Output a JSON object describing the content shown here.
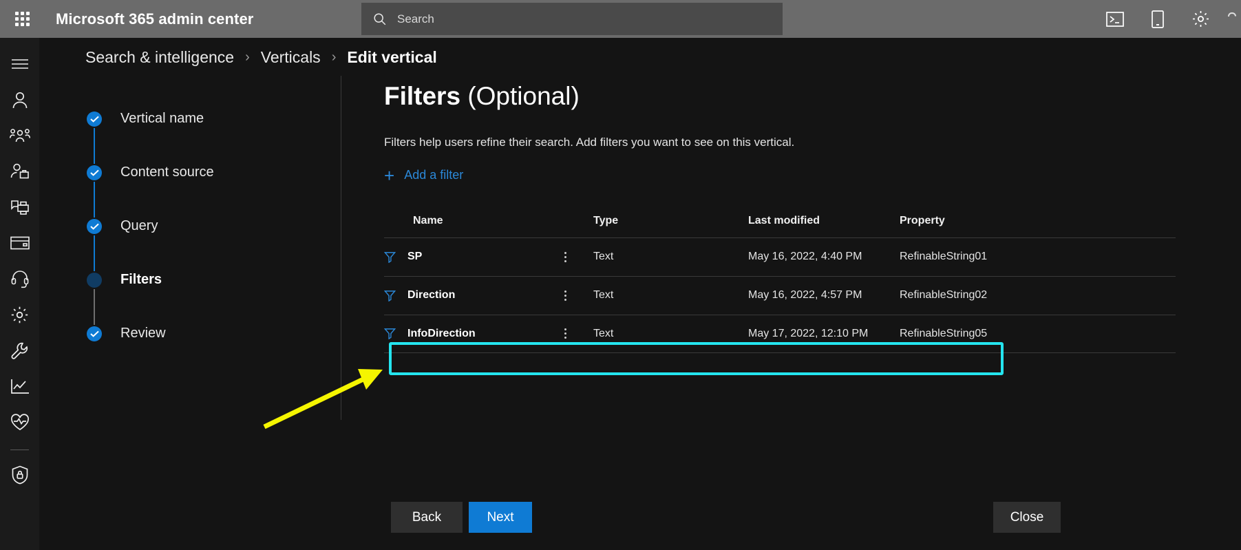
{
  "topbar": {
    "waffle_label": "app-launcher",
    "brand": "Microsoft 365 admin center",
    "search": {
      "value": "",
      "placeholder": "Search"
    },
    "icons": [
      {
        "name": "console-icon",
        "label": "Open command prompt"
      },
      {
        "name": "mobile-device-icon",
        "label": "Mobile device"
      },
      {
        "name": "gear-icon",
        "label": "Settings"
      }
    ]
  },
  "rail": {
    "items": [
      {
        "name": "hamburger-menu-icon",
        "label": "Show navigation menu"
      },
      {
        "name": "user-icon",
        "label": "Users"
      },
      {
        "name": "group-users-icon",
        "label": "Teams & groups"
      },
      {
        "name": "user-briefcase-icon",
        "label": "Roles"
      },
      {
        "name": "devices-printer-icon",
        "label": "Devices"
      },
      {
        "name": "credit-card-icon",
        "label": "Billing"
      },
      {
        "name": "headset-icon",
        "label": "Support"
      },
      {
        "name": "gear-icon",
        "label": "Settings"
      },
      {
        "name": "wrench-icon",
        "label": "Setup"
      },
      {
        "name": "chart-line-icon",
        "label": "Reports"
      },
      {
        "name": "heart-pulse-icon",
        "label": "Health"
      },
      {
        "name": "shield-lock-icon",
        "label": "Compliance"
      }
    ]
  },
  "breadcrumb": {
    "root": "Search & intelligence",
    "separator": "›",
    "parent": "Verticals",
    "current": "Edit vertical"
  },
  "wizard": {
    "steps": [
      {
        "label": "Vertical name",
        "state": "done"
      },
      {
        "label": "Content source",
        "state": "done"
      },
      {
        "label": "Query",
        "state": "done"
      },
      {
        "label": "Filters",
        "state": "current"
      },
      {
        "label": "Review",
        "state": "done"
      }
    ]
  },
  "main": {
    "title_bold": "Filters",
    "title_optional": " (Optional)",
    "description": "Filters help users refine their search. Add filters you want to see on this vertical.",
    "add_filter_label": "Add a filter",
    "add_filter_plus": "+",
    "table": {
      "columns": [
        "Name",
        "Type",
        "Last modified",
        "Property"
      ],
      "rows": [
        {
          "name": "SP",
          "type": "Text",
          "last_modified": "May 16, 2022, 4:40 PM",
          "property": "RefinableString01",
          "highlighted": false
        },
        {
          "name": "Direction",
          "type": "Text",
          "last_modified": "May 16, 2022, 4:57 PM",
          "property": "RefinableString02",
          "highlighted": false
        },
        {
          "name": "InfoDirection",
          "type": "Text",
          "last_modified": "May 17, 2022, 12:10 PM",
          "property": "RefinableString05",
          "highlighted": true
        }
      ]
    }
  },
  "footer": {
    "back": "Back",
    "next": "Next",
    "close": "Close"
  },
  "annotation": {
    "highlight_color": "#24e5ef",
    "arrow_color": "#f5f500"
  },
  "colors": {
    "accent_blue": "#0f7bd4",
    "link_blue": "#2b88d8",
    "topbar_gray": "#6b6b6b",
    "page_bg": "#141414",
    "rail_bg": "#1b1b1b"
  }
}
